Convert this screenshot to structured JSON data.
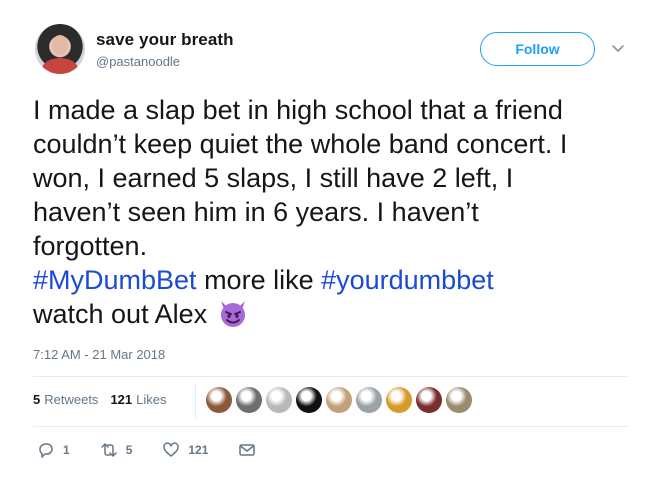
{
  "author": {
    "display_name": "save your breath",
    "handle": "@pastanoodle"
  },
  "follow_label": "Follow",
  "tweet": {
    "lines": [
      "I made a slap bet in high school that a friend",
      "couldn’t keep quiet the whole band concert. I",
      "won, I earned 5 slaps, I still have 2 left, I",
      "haven’t seen him in 6 years. I haven’t",
      "forgotten."
    ],
    "hashtag1": "#MyDumbBet",
    "middle_text": " more like ",
    "hashtag2": "#yourdumbbet",
    "last_line": "watch out Alex ",
    "emoji": "smiling-imp-emoji"
  },
  "timestamp": "7:12 AM - 21 Mar 2018",
  "stats": {
    "retweets_count": "5",
    "retweets_label": "Retweets",
    "likes_count": "121",
    "likes_label": "Likes"
  },
  "actions": {
    "reply_count": "1",
    "retweet_count": "5",
    "like_count": "121"
  },
  "colors": {
    "accent": "#1da1f2",
    "hashtag": "#1b4bd1",
    "secondary_text": "#657786"
  },
  "likers": [
    {
      "color": "#8a5a3a"
    },
    {
      "color": "#6e6e6e"
    },
    {
      "color": "#b9b9b9"
    },
    {
      "color": "#111111"
    },
    {
      "color": "#c4a07a"
    },
    {
      "color": "#9aa3a6"
    },
    {
      "color": "#d89b2a"
    },
    {
      "color": "#7a2e2e"
    },
    {
      "color": "#9c8a6c"
    }
  ]
}
